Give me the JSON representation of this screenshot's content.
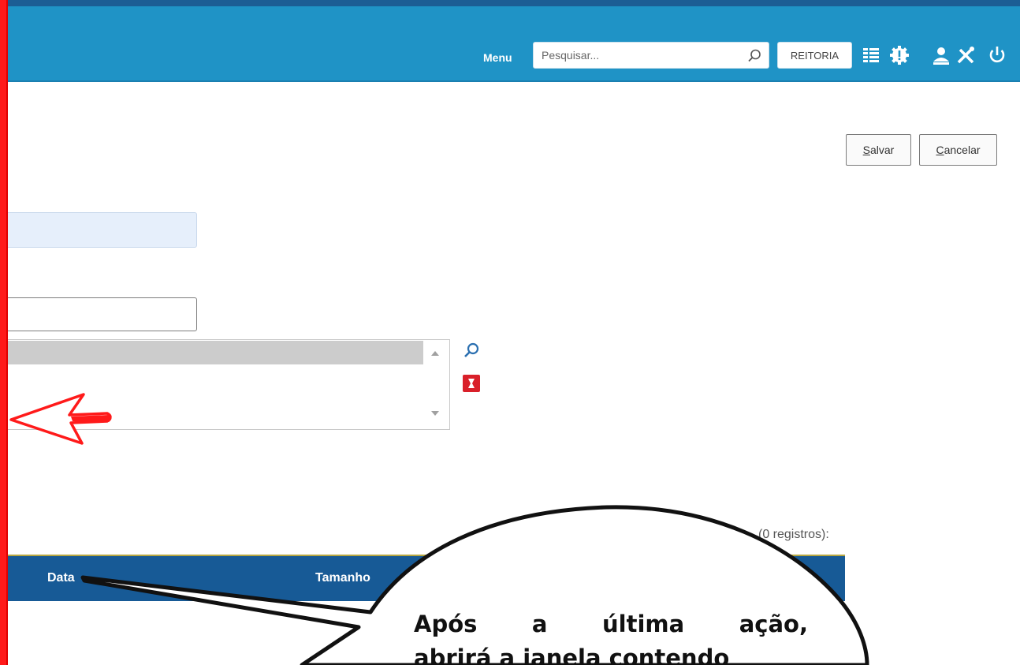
{
  "header": {
    "menu_label": "Menu",
    "search": {
      "placeholder": "Pesquisar...",
      "value": ""
    },
    "unit_badge": "REITORIA",
    "icons": [
      "list-icon",
      "settings-gear-icon",
      "user-icon",
      "tools-icon",
      "power-icon"
    ],
    "colors": {
      "header_bg": "#1f93c6",
      "top_strip": "#1c5d94"
    }
  },
  "actions": {
    "save_underlined": "S",
    "save_rest": "alvar",
    "cancel_underlined": "C",
    "cancel_rest": "ancelar"
  },
  "form": {
    "readonly_field_value": "",
    "input_field_value": ""
  },
  "table": {
    "records_label": "(0 registros):",
    "columns": [
      "Data",
      "Tamanho"
    ],
    "header_color": "#175a96"
  },
  "callout": {
    "line1": "Após a última ação,",
    "line2": "abrirá a janela contendo"
  },
  "colors": {
    "left_bar": "#ff1a1a",
    "arrow": "#ff1a1a"
  }
}
